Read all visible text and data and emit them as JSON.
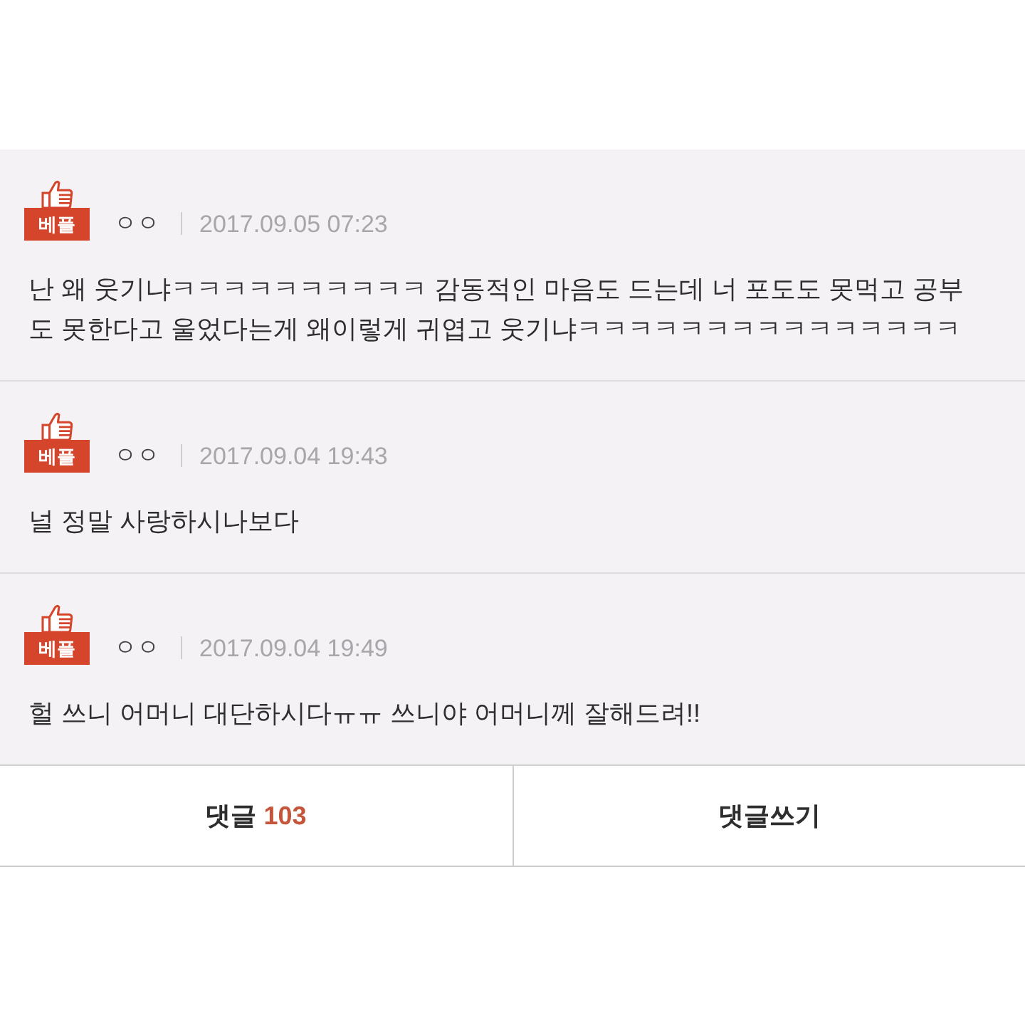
{
  "comments": [
    {
      "badge": "베플",
      "author": "ㅇㅇ",
      "date": "2017.09.05 07:23",
      "text": "난 왜 웃기냐ㅋㅋㅋㅋㅋㅋㅋㅋㅋㅋ 감동적인 마음도 드는데 너 포도도 못먹고 공부도 못한다고 울었다는게 왜이렇게 귀엽고 웃기냐ㅋㅋㅋㅋㅋㅋㅋㅋㅋㅋㅋㅋㅋㅋㅋ"
    },
    {
      "badge": "베플",
      "author": "ㅇㅇ",
      "date": "2017.09.04 19:43",
      "text": "널 정말 사랑하시나보다"
    },
    {
      "badge": "베플",
      "author": "ㅇㅇ",
      "date": "2017.09.04 19:49",
      "text": "헐 쓰니 어머니 대단하시다ㅠㅠ 쓰니야 어머니께 잘해드려!!"
    }
  ],
  "footer": {
    "comments_label": "댓글",
    "comments_count": "103",
    "write_label": "댓글쓰기"
  }
}
